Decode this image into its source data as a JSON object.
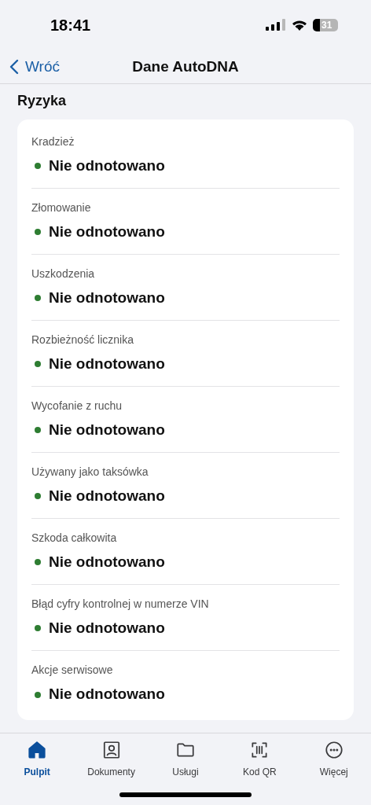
{
  "status_bar": {
    "time": "18:41",
    "battery": "31"
  },
  "nav": {
    "back": "Wróć",
    "title": "Dane AutoDNA"
  },
  "section": {
    "title": "Ryzyka"
  },
  "risks": [
    {
      "label": "Kradzież",
      "status": "Nie odnotowano",
      "color": "#2e7d32"
    },
    {
      "label": "Złomowanie",
      "status": "Nie odnotowano",
      "color": "#2e7d32"
    },
    {
      "label": "Uszkodzenia",
      "status": "Nie odnotowano",
      "color": "#2e7d32"
    },
    {
      "label": "Rozbieżność licznika",
      "status": "Nie odnotowano",
      "color": "#2e7d32"
    },
    {
      "label": "Wycofanie z ruchu",
      "status": "Nie odnotowano",
      "color": "#2e7d32"
    },
    {
      "label": "Używany jako taksówka",
      "status": "Nie odnotowano",
      "color": "#2e7d32"
    },
    {
      "label": "Szkoda całkowita",
      "status": "Nie odnotowano",
      "color": "#2e7d32"
    },
    {
      "label": "Błąd cyfry kontrolnej w numerze VIN",
      "status": "Nie odnotowano",
      "color": "#2e7d32"
    },
    {
      "label": "Akcje serwisowe",
      "status": "Nie odnotowano",
      "color": "#2e7d32"
    }
  ],
  "tabs": [
    {
      "kind": "home",
      "label": "Pulpit",
      "selected": true
    },
    {
      "kind": "documents",
      "label": "Dokumenty",
      "selected": false
    },
    {
      "kind": "services",
      "label": "Usługi",
      "selected": false
    },
    {
      "kind": "qr",
      "label": "Kod QR",
      "selected": false
    },
    {
      "kind": "more",
      "label": "Więcej",
      "selected": false
    }
  ]
}
